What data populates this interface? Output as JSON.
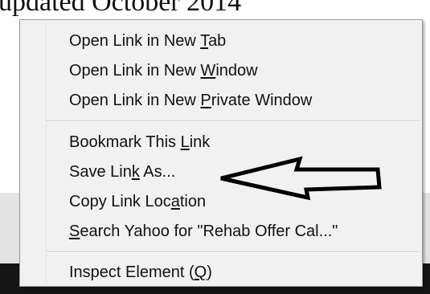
{
  "background": {
    "heading_fragment": "updated October 2014"
  },
  "context_menu": {
    "items": [
      {
        "id": "open-new-tab",
        "before": "Open Link in New ",
        "accel": "T",
        "after": "ab"
      },
      {
        "id": "open-new-window",
        "before": "Open Link in New ",
        "accel": "W",
        "after": "indow"
      },
      {
        "id": "open-private-window",
        "before": "Open Link in New ",
        "accel": "P",
        "after": "rivate Window"
      },
      {
        "id": "bookmark-link",
        "before": "Bookmark This ",
        "accel": "L",
        "after": "ink"
      },
      {
        "id": "save-link-as",
        "before": "Save Lin",
        "accel": "k",
        "after": " As..."
      },
      {
        "id": "copy-link-location",
        "before": "Copy Link Loc",
        "accel": "a",
        "after": "tion"
      },
      {
        "id": "search-yahoo",
        "before": "",
        "accel": "S",
        "after": "earch Yahoo for \"Rehab Offer Cal...\""
      },
      {
        "id": "inspect-element",
        "before": "Inspect Element (",
        "accel": "Q",
        "after": ")"
      }
    ]
  },
  "annotation": {
    "arrow_icon": "left-arrow-outline",
    "arrow_color": "#000000"
  }
}
